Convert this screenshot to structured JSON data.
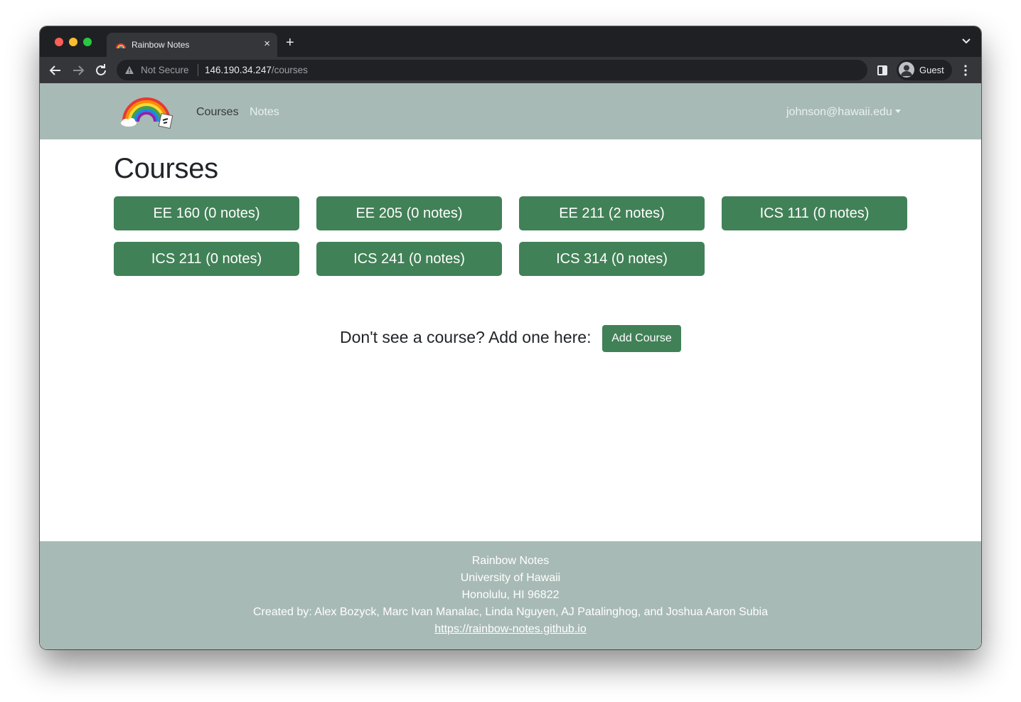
{
  "browser": {
    "tab_title": "Rainbow Notes",
    "tab_close_glyph": "×",
    "new_tab_glyph": "+",
    "security_label": "Not Secure",
    "url_host": "146.190.34.247",
    "url_path": "/courses",
    "profile_label": "Guest",
    "icons": [
      "back-arrow-icon",
      "forward-arrow-icon",
      "reload-icon",
      "warning-icon",
      "side-panel-icon",
      "profile-icon",
      "more-menu-icon",
      "tab-list-icon"
    ]
  },
  "navbar": {
    "links": [
      {
        "label": "Courses",
        "active": true
      },
      {
        "label": "Notes",
        "active": false
      }
    ],
    "user_email": "johnson@hawaii.edu"
  },
  "main": {
    "title": "Courses",
    "courses": [
      {
        "label": "EE 160 (0 notes)"
      },
      {
        "label": "EE 205 (0 notes)"
      },
      {
        "label": "EE 211 (2 notes)"
      },
      {
        "label": "ICS 111 (0 notes)"
      },
      {
        "label": "ICS 211 (0 notes)"
      },
      {
        "label": "ICS 241 (0 notes)"
      },
      {
        "label": "ICS 314 (0 notes)"
      }
    ],
    "add_prompt": "Don't see a course? Add one here:",
    "add_button": "Add Course"
  },
  "footer": {
    "name": "Rainbow Notes",
    "university": "University of Hawaii",
    "address": "Honolulu, HI 96822",
    "credits": "Created by: Alex Bozyck, Marc Ivan Manalac, Linda Nguyen, AJ Patalinghog, and Joshua Aaron Subia",
    "link": "https://rainbow-notes.github.io"
  },
  "colors": {
    "navbar_bg": "#a8bab5",
    "button_green": "#418157",
    "chrome_dark": "#35363a"
  }
}
